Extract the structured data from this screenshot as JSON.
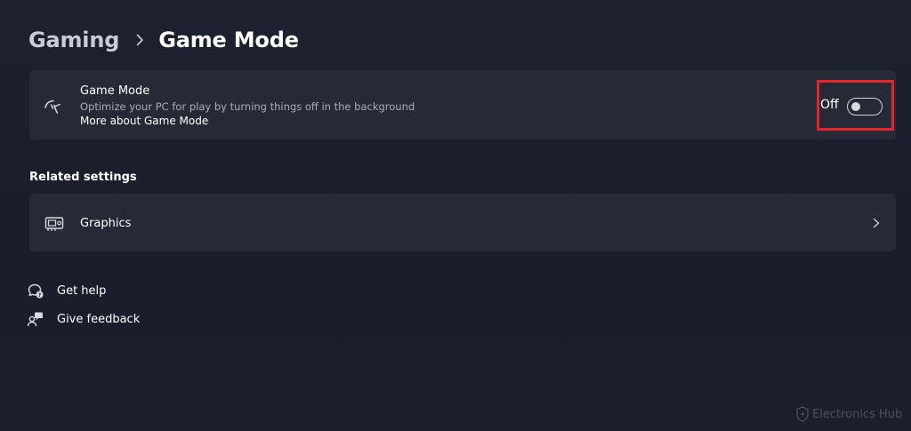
{
  "breadcrumb": {
    "parent": "Gaming",
    "current": "Game Mode",
    "separator_icon": "chevron-right-icon"
  },
  "game_mode_card": {
    "icon": "game-mode-gauge-icon",
    "title": "Game Mode",
    "description": "Optimize your PC for play by turning things off in the background",
    "link": "More about Game Mode",
    "toggle": {
      "state_label": "Off",
      "on": false
    },
    "highlight_color": "#e4232b"
  },
  "related_settings": {
    "heading": "Related settings",
    "items": [
      {
        "label": "Graphics",
        "icon": "graphics-card-icon",
        "chevron": "chevron-right-icon"
      }
    ]
  },
  "help_links": [
    {
      "label": "Get help",
      "icon": "help-chat-icon"
    },
    {
      "label": "Give feedback",
      "icon": "feedback-person-icon"
    }
  ],
  "watermark": {
    "text": "Electronics Hub",
    "icon": "shield-logo-icon"
  },
  "colors": {
    "background": "#1b1f2d",
    "card": "#262a37",
    "text_primary": "#ffffff",
    "text_secondary": "#a8adb8",
    "highlight": "#e4232b"
  }
}
